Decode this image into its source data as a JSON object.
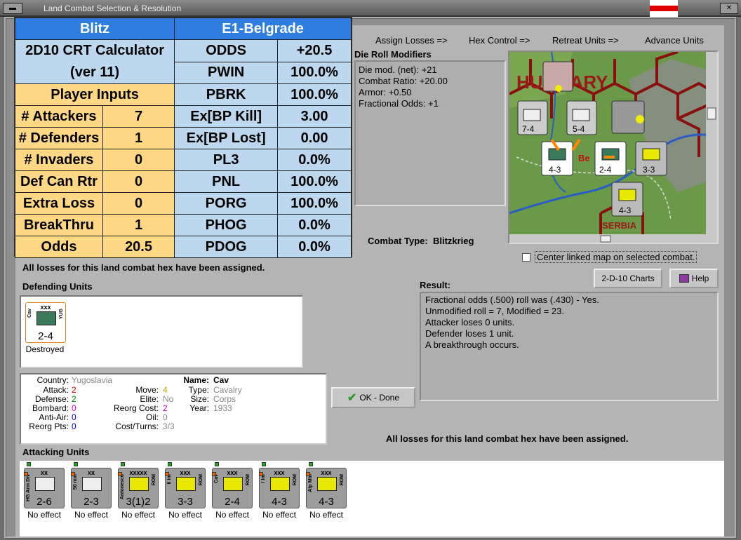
{
  "window": {
    "title": "Land Combat Selection & Resolution"
  },
  "crt": {
    "title": "Blitz",
    "hex": "E1-Belgrade",
    "calc_name": "2D10 CRT Calculator",
    "version": "(ver 11)",
    "inputs_header": "Player Inputs",
    "inputs": [
      {
        "label": "# Attackers",
        "value": "7"
      },
      {
        "label": "# Defenders",
        "value": "1"
      },
      {
        "label": "# Invaders",
        "value": "0"
      },
      {
        "label": "Def Can Rtr",
        "value": "0"
      },
      {
        "label": "Extra Loss",
        "value": "0"
      },
      {
        "label": "BreakThru",
        "value": "1"
      },
      {
        "label": "Odds",
        "value": "20.5"
      }
    ],
    "outputs": [
      {
        "label": "ODDS",
        "value": "+20.5"
      },
      {
        "label": "PWIN",
        "value": "100.0%"
      },
      {
        "label": "PBRK",
        "value": "100.0%"
      },
      {
        "label": "Ex[BP Kill]",
        "value": "3.00"
      },
      {
        "label": "Ex[BP Lost]",
        "value": "0.00"
      },
      {
        "label": "PL3",
        "value": "0.0%"
      },
      {
        "label": "PNL",
        "value": "100.0%"
      },
      {
        "label": "PORG",
        "value": "100.0%"
      },
      {
        "label": "PHOG",
        "value": "0.0%"
      },
      {
        "label": "PDOG",
        "value": "0.0%"
      }
    ]
  },
  "tabs": [
    "Assign Losses =>",
    "Hex Control =>",
    "Retreat Units =>",
    "Advance Units"
  ],
  "die_roll": {
    "header": "Die Roll Modifiers",
    "lines": [
      "Die mod. (net): +21",
      "",
      "Combat Ratio: +20.00",
      "Armor: +0.50",
      "Fractional Odds: +1"
    ]
  },
  "map": {
    "labels": {
      "hungary": "HUNGARY",
      "serbia": "SERBIA",
      "belgrade": "Be"
    }
  },
  "combat_type": {
    "label": "Combat Type:",
    "value": "Blitzkrieg"
  },
  "center_linked": "Center linked map on selected combat.",
  "losses_msg": "All losses for this land combat hex have been assigned.",
  "defending": {
    "header": "Defending Units",
    "units": [
      {
        "size": "xxx",
        "side": "Cav",
        "nation": "YUG",
        "strength": "2-4",
        "status": "Destroyed"
      }
    ]
  },
  "result": {
    "header": "Result:",
    "lines": [
      "Fractional odds (.500) roll was (.430)  - Yes.",
      "Unmodified roll = 7, Modified = 23.",
      "Attacker loses 0 units.",
      "Defender loses 1 unit.",
      "A breakthrough occurs."
    ]
  },
  "buttons": {
    "charts": "2-D-10 Charts",
    "help": "Help",
    "ok": "OK - Done"
  },
  "unit_info": {
    "country_label": "Country:",
    "country": "Yugoslavia",
    "attack_label": "Attack:",
    "attack": "2",
    "defense_label": "Defense:",
    "defense": "2",
    "bombard_label": "Bombard:",
    "bombard": "0",
    "antiair_label": "Anti-Air:",
    "antiair": "0",
    "reorg_pts_label": "Reorg Pts:",
    "reorg_pts": "0",
    "move_label": "Move:",
    "move": "4",
    "elite_label": "Elite:",
    "elite": "No",
    "reorg_cost_label": "Reorg Cost:",
    "reorg_cost": "2",
    "oil_label": "Oil:",
    "oil": "0",
    "cost_turns_label": "Cost/Turns:",
    "cost_turns": "3/3",
    "name_label": "Name:",
    "name": "Cav",
    "type_label": "Type:",
    "type": "Cavalry",
    "size_label": "Size:",
    "size": "Corps",
    "year_label": "Year:",
    "year": "1933"
  },
  "attacking": {
    "header": "Attacking Units",
    "units": [
      {
        "size": "xx",
        "side": "HG Arm Div",
        "nation": "",
        "strength": "2-6",
        "status": "No effect"
      },
      {
        "size": "xx",
        "side": "50 mm",
        "nation": "",
        "strength": "2-3",
        "status": "No effect"
      },
      {
        "size": "xxxxx",
        "side": "Antonescu",
        "nation": "ROM",
        "strength": "3(1)2",
        "status": "No effect"
      },
      {
        "size": "xxx",
        "side": "II Inf",
        "nation": "ROM",
        "strength": "3-3",
        "status": "No effect"
      },
      {
        "size": "xxx",
        "side": "Cav",
        "nation": "ROM",
        "strength": "2-4",
        "status": "No effect"
      },
      {
        "size": "xxx",
        "side": "I Inf",
        "nation": "ROM",
        "strength": "4-3",
        "status": "No effect"
      },
      {
        "size": "xxx",
        "side": "Alp Mtn",
        "nation": "ROM",
        "strength": "4-3",
        "status": "No effect"
      }
    ]
  },
  "colors": {
    "dark_blue": "#2f7de0",
    "light_blue": "#bdd7ee",
    "yellow": "#ffd885",
    "counter_yellow": "#e8e800"
  }
}
